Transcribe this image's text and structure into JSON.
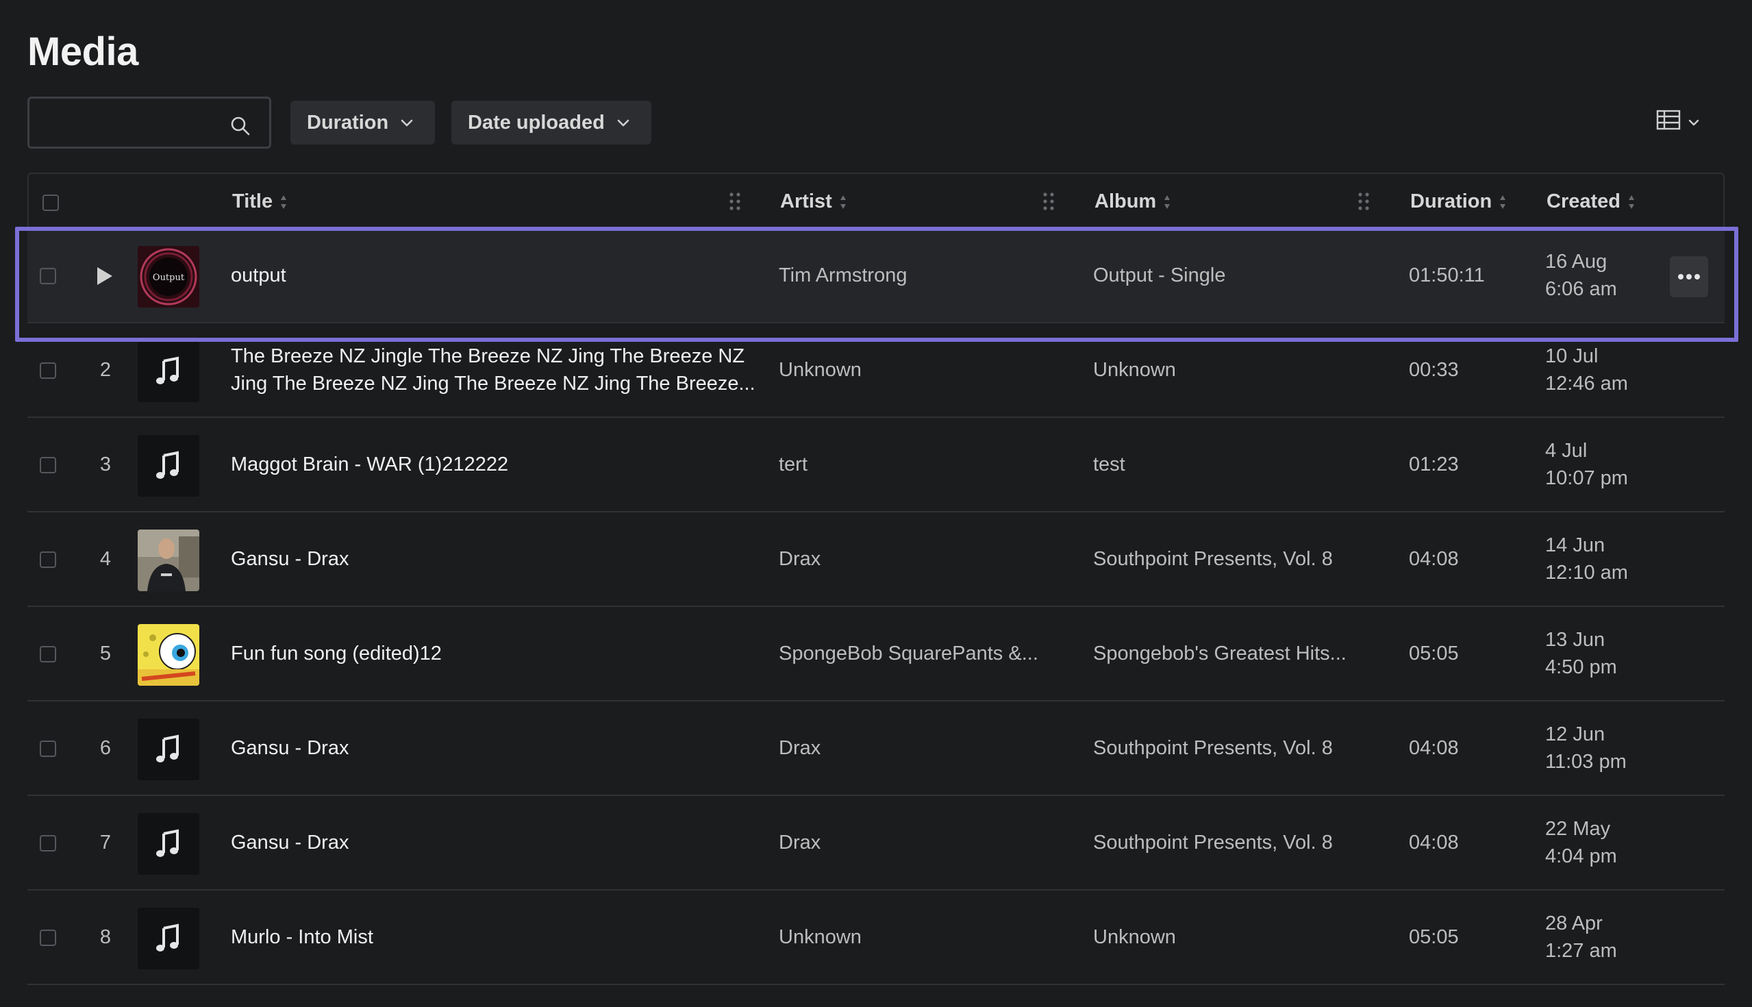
{
  "page": {
    "title": "Media"
  },
  "search": {
    "placeholder": "",
    "value": ""
  },
  "filters": {
    "duration_label": "Duration",
    "date_label": "Date uploaded"
  },
  "table": {
    "columns": {
      "title": "Title",
      "artist": "Artist",
      "album": "Album",
      "duration": "Duration",
      "created": "Created"
    },
    "rows": [
      {
        "num": "",
        "title_line1": "output",
        "title_line2": "",
        "artist": "Tim Armstrong",
        "album": "Output - Single",
        "duration": "01:50:11",
        "created_date": "16 Aug",
        "created_time": "6:06 am",
        "thumb": "output-cover",
        "thumb_text": "Output",
        "selected": true
      },
      {
        "num": "2",
        "title_line1": "The Breeze NZ Jingle The Breeze NZ Jing The Breeze NZ",
        "title_line2": "Jing The Breeze NZ Jing The Breeze NZ Jing The Breeze...",
        "artist": "Unknown",
        "album": "Unknown",
        "duration": "00:33",
        "created_date": "10 Jul",
        "created_time": "12:46 am",
        "thumb": "music-note-icon"
      },
      {
        "num": "3",
        "title_line1": "Maggot Brain - WAR (1)212222",
        "title_line2": "",
        "artist": "tert",
        "album": "test",
        "duration": "01:23",
        "created_date": "4 Jul",
        "created_time": "10:07 pm",
        "thumb": "music-note-icon"
      },
      {
        "num": "4",
        "title_line1": "Gansu - Drax",
        "title_line2": "",
        "artist": "Drax",
        "album": "Southpoint Presents, Vol. 8",
        "duration": "04:08",
        "created_date": "14 Jun",
        "created_time": "12:10 am",
        "thumb": "person-photo"
      },
      {
        "num": "5",
        "title_line1": "Fun fun song (edited)12",
        "title_line2": "",
        "artist": "SpongeBob SquarePants &...",
        "album": "Spongebob's Greatest Hits...",
        "duration": "05:05",
        "created_date": "13 Jun",
        "created_time": "4:50 pm",
        "thumb": "spongebob-cover"
      },
      {
        "num": "6",
        "title_line1": "Gansu - Drax",
        "title_line2": "",
        "artist": "Drax",
        "album": "Southpoint Presents, Vol. 8",
        "duration": "04:08",
        "created_date": "12 Jun",
        "created_time": "11:03 pm",
        "thumb": "music-note-icon"
      },
      {
        "num": "7",
        "title_line1": "Gansu - Drax",
        "title_line2": "",
        "artist": "Drax",
        "album": "Southpoint Presents, Vol. 8",
        "duration": "04:08",
        "created_date": "22 May",
        "created_time": "4:04 pm",
        "thumb": "music-note-icon"
      },
      {
        "num": "8",
        "title_line1": "Murlo - Into Mist",
        "title_line2": "",
        "artist": "Unknown",
        "album": "Unknown",
        "duration": "05:05",
        "created_date": "28 Apr",
        "created_time": "1:27 am",
        "thumb": "music-note-icon"
      }
    ]
  },
  "colors": {
    "background": "#1b1c1e",
    "selection_outline": "#7b6fd6",
    "row_divider": "#2f3134"
  }
}
